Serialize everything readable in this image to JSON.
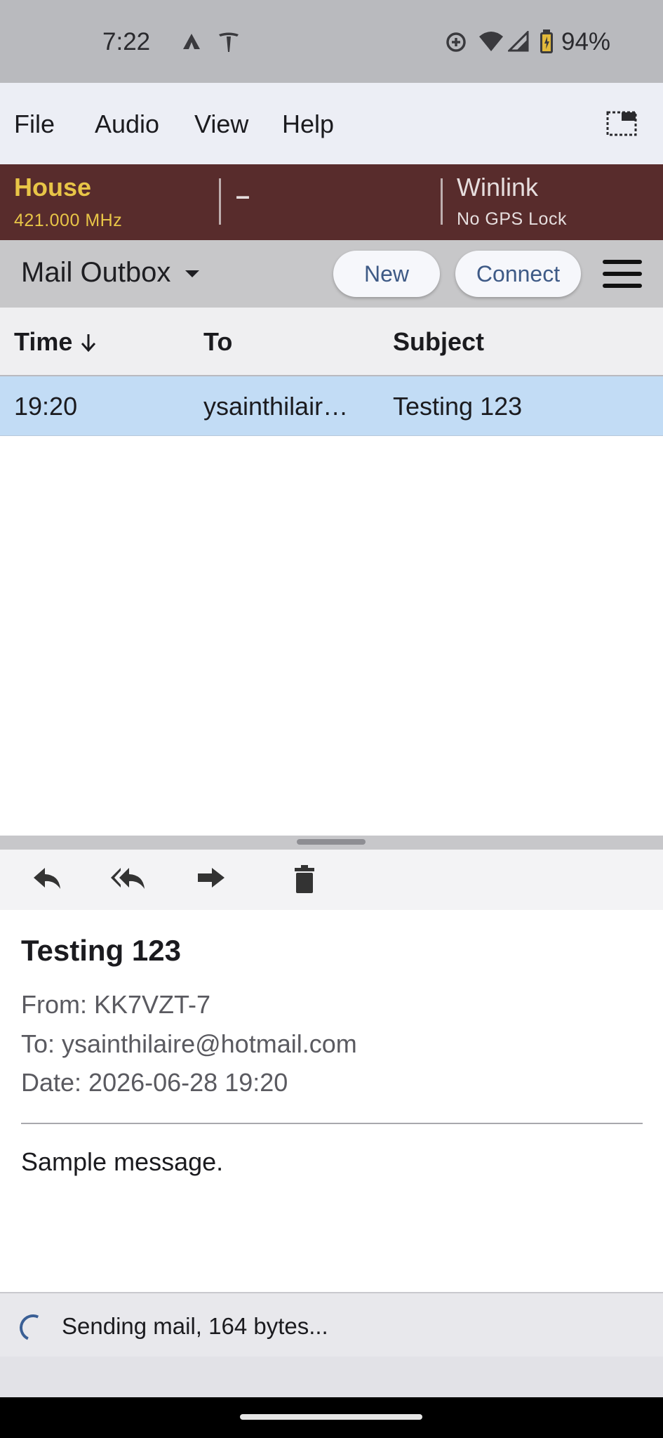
{
  "status_bar": {
    "time": "7:22",
    "battery": "94%",
    "icons": [
      "cell-notification-icon",
      "tesla-icon",
      "data-saver-icon",
      "wifi-icon",
      "signal-icon",
      "battery-charging-icon"
    ]
  },
  "menu": {
    "file": "File",
    "audio": "Audio",
    "view": "View",
    "help": "Help",
    "window_icon": "window-layout-icon"
  },
  "radio": {
    "channel_name": "House",
    "frequency": "421.000 MHz",
    "middle": "–",
    "mode": "Winlink",
    "gps": "No GPS Lock",
    "colors": {
      "background": "#582c2c",
      "channel": "#e8c547",
      "mode": "#e6dede"
    }
  },
  "toolbar": {
    "title": "Mail Outbox",
    "new_label": "New",
    "connect_label": "Connect",
    "menu_icon": "hamburger-menu-icon"
  },
  "table": {
    "headers": {
      "time": "Time",
      "to": "To",
      "subject": "Subject"
    },
    "sort_icon": "arrow-down-icon",
    "rows": [
      {
        "time": "19:20",
        "to": "ysainthilair…",
        "subject": "Testing 123"
      }
    ],
    "selected_color": "#c2dcf5"
  },
  "actions": [
    "reply-icon",
    "reply-all-icon",
    "forward-icon",
    "delete-icon"
  ],
  "message": {
    "subject": "Testing 123",
    "from": "From: KK7VZT-7",
    "to": "To: ysainthilaire@hotmail.com",
    "date": "Date: 2026-06-28 19:20",
    "body": "Sample message."
  },
  "status": {
    "text": "Sending mail, 164 bytes..."
  }
}
